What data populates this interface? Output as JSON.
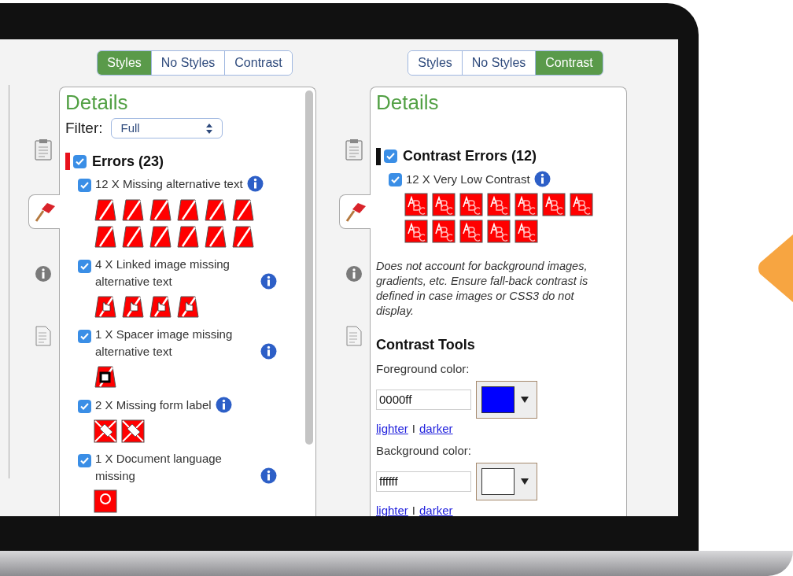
{
  "panels": [
    {
      "tabs": [
        {
          "label": "Styles",
          "selected": true
        },
        {
          "label": "No Styles",
          "selected": false
        },
        {
          "label": "Contrast",
          "selected": false
        }
      ],
      "side_tabs": [
        {
          "kind": "clipboard",
          "selected": false
        },
        {
          "kind": "flag",
          "selected": true
        },
        {
          "kind": "info",
          "selected": false
        },
        {
          "kind": "document",
          "selected": false
        }
      ],
      "title": "Details",
      "filter": {
        "label": "Filter:",
        "value": "Full"
      },
      "groups": [
        {
          "label": "Errors (23)",
          "checked": true,
          "color": "#e8111b",
          "items": [
            {
              "label": "12 X Missing alternative text",
              "checked": true,
              "icons": [
                {
                  "kind": "alt"
                },
                {
                  "kind": "alt"
                },
                {
                  "kind": "alt"
                },
                {
                  "kind": "alt"
                },
                {
                  "kind": "alt"
                },
                {
                  "kind": "alt"
                },
                {
                  "kind": "alt"
                },
                {
                  "kind": "alt"
                },
                {
                  "kind": "alt"
                },
                {
                  "kind": "alt"
                },
                {
                  "kind": "alt"
                },
                {
                  "kind": "alt"
                }
              ]
            },
            {
              "label": "4 X Linked image missing alternative text",
              "checked": true,
              "icons": [
                {
                  "kind": "linked"
                },
                {
                  "kind": "linked"
                },
                {
                  "kind": "linked"
                },
                {
                  "kind": "linked"
                }
              ]
            },
            {
              "label": "1 X Spacer image missing alternative text",
              "checked": true,
              "icons": [
                {
                  "kind": "spacer"
                }
              ]
            },
            {
              "label": "2 X Missing form label",
              "checked": true,
              "icons": [
                {
                  "kind": "label"
                },
                {
                  "kind": "label"
                }
              ]
            },
            {
              "label": "1 X Document language missing",
              "checked": true,
              "icons": [
                {
                  "kind": "lang"
                }
              ]
            }
          ]
        }
      ],
      "scrollbar": true
    },
    {
      "tabs": [
        {
          "label": "Styles",
          "selected": false
        },
        {
          "label": "No Styles",
          "selected": false
        },
        {
          "label": "Contrast",
          "selected": true
        }
      ],
      "side_tabs": [
        {
          "kind": "clipboard",
          "selected": false
        },
        {
          "kind": "flag",
          "selected": true
        },
        {
          "kind": "info",
          "selected": false
        },
        {
          "kind": "document",
          "selected": false
        }
      ],
      "title": "Details",
      "groups": [
        {
          "label": "Contrast Errors (12)",
          "checked": true,
          "color": "#111111",
          "items": [
            {
              "label": "12 X Very Low Contrast",
              "checked": true,
              "icons": [
                {
                  "kind": "contrast"
                },
                {
                  "kind": "contrast"
                },
                {
                  "kind": "contrast"
                },
                {
                  "kind": "contrast"
                },
                {
                  "kind": "contrast"
                },
                {
                  "kind": "contrast"
                },
                {
                  "kind": "contrast"
                },
                {
                  "kind": "contrast"
                },
                {
                  "kind": "contrast"
                },
                {
                  "kind": "contrast"
                },
                {
                  "kind": "contrast"
                },
                {
                  "kind": "contrast"
                }
              ]
            }
          ]
        }
      ],
      "note": "Does not account for background images, gradients, etc. Ensure fall-back contrast is defined in case images or CSS3 do not display.",
      "tools": {
        "heading": "Contrast Tools",
        "fields": [
          {
            "label": "Foreground color:",
            "value": "0000ff",
            "color": "#0000ff",
            "lighter": "lighter",
            "separator": "I",
            "darker": "darker"
          },
          {
            "label": "Background color:",
            "value": "ffffff",
            "color": "#ffffff",
            "lighter": "lighter",
            "separator": "I",
            "darker": "darker"
          }
        ]
      },
      "scrollbar": false
    }
  ]
}
